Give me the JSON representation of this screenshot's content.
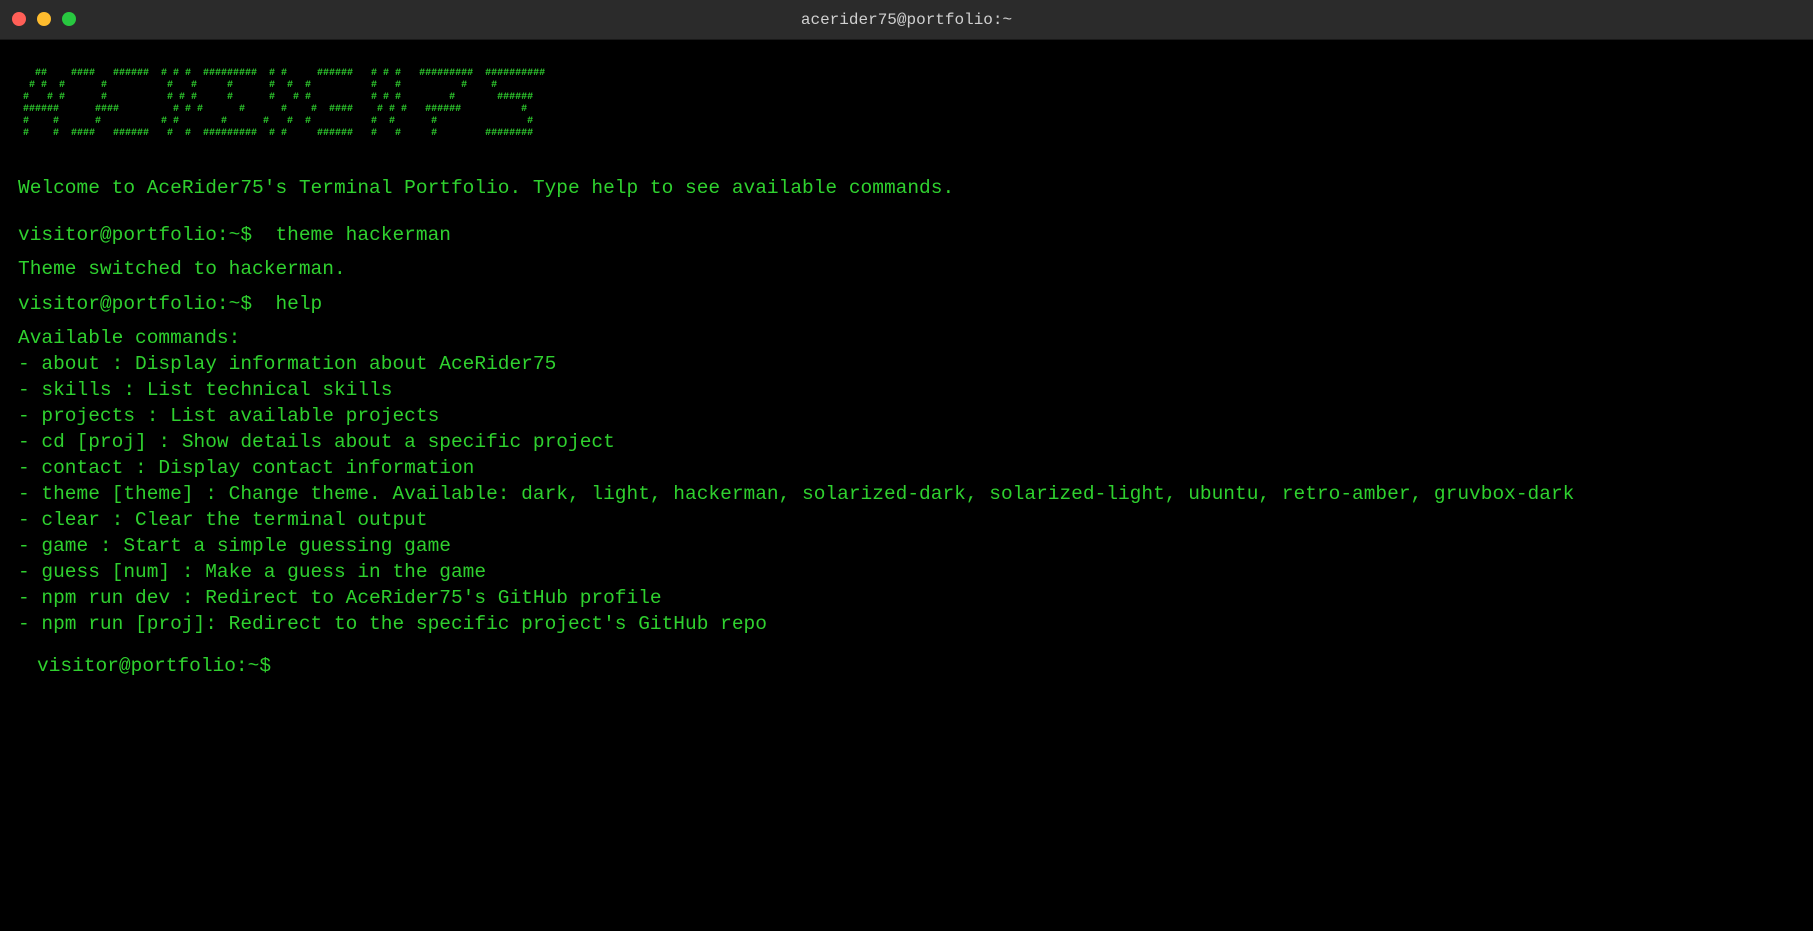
{
  "window": {
    "title": "acerider75@portfolio:~"
  },
  "banner": {
    "ascii": "  ##    ####   ######  # # #  #########  # #     ######   # # #   #########  ##########\n # #  #      #          #   #     #      #  #  #          #   #          #    #\n#   # #      #          # # #     #      #   # #          # # #        #       ######\n######      ####         # # #      #      #    #  ####    # # #   ######          #\n#    #      #          # #       #      #   #  #          #  #      #               #\n#    #  ####   ######   #  #  #########  # #     ######   #   #     #        ########"
  },
  "terminal": {
    "welcome": "Welcome to AceRider75's Terminal Portfolio. Type help to see available commands.",
    "prompt": "visitor@portfolio:~$",
    "history": [
      {
        "command": "theme hackerman",
        "output": "Theme switched to hackerman."
      },
      {
        "command": "help",
        "output": "Available commands:"
      }
    ],
    "commands": [
      "- about : Display information about AceRider75",
      "- skills : List technical skills",
      "- projects : List available projects",
      "- cd [proj] : Show details about a specific project",
      "- contact : Display contact information",
      "- theme [theme] : Change theme. Available: dark, light, hackerman, solarized-dark, solarized-light, ubuntu, retro-amber, gruvbox-dark",
      "- clear : Clear the terminal output",
      "- game : Start a simple guessing game",
      "- guess [num] : Make a guess in the game",
      "- npm run dev : Redirect to AceRider75's GitHub profile",
      "- npm run [proj]: Redirect to the specific project's GitHub repo"
    ],
    "current_input": ""
  },
  "colors": {
    "background": "#000000",
    "text": "#2fd12f",
    "titlebar": "#2b2b2b",
    "close": "#ff5f57",
    "minimize": "#febc2e",
    "maximize": "#28c840"
  }
}
